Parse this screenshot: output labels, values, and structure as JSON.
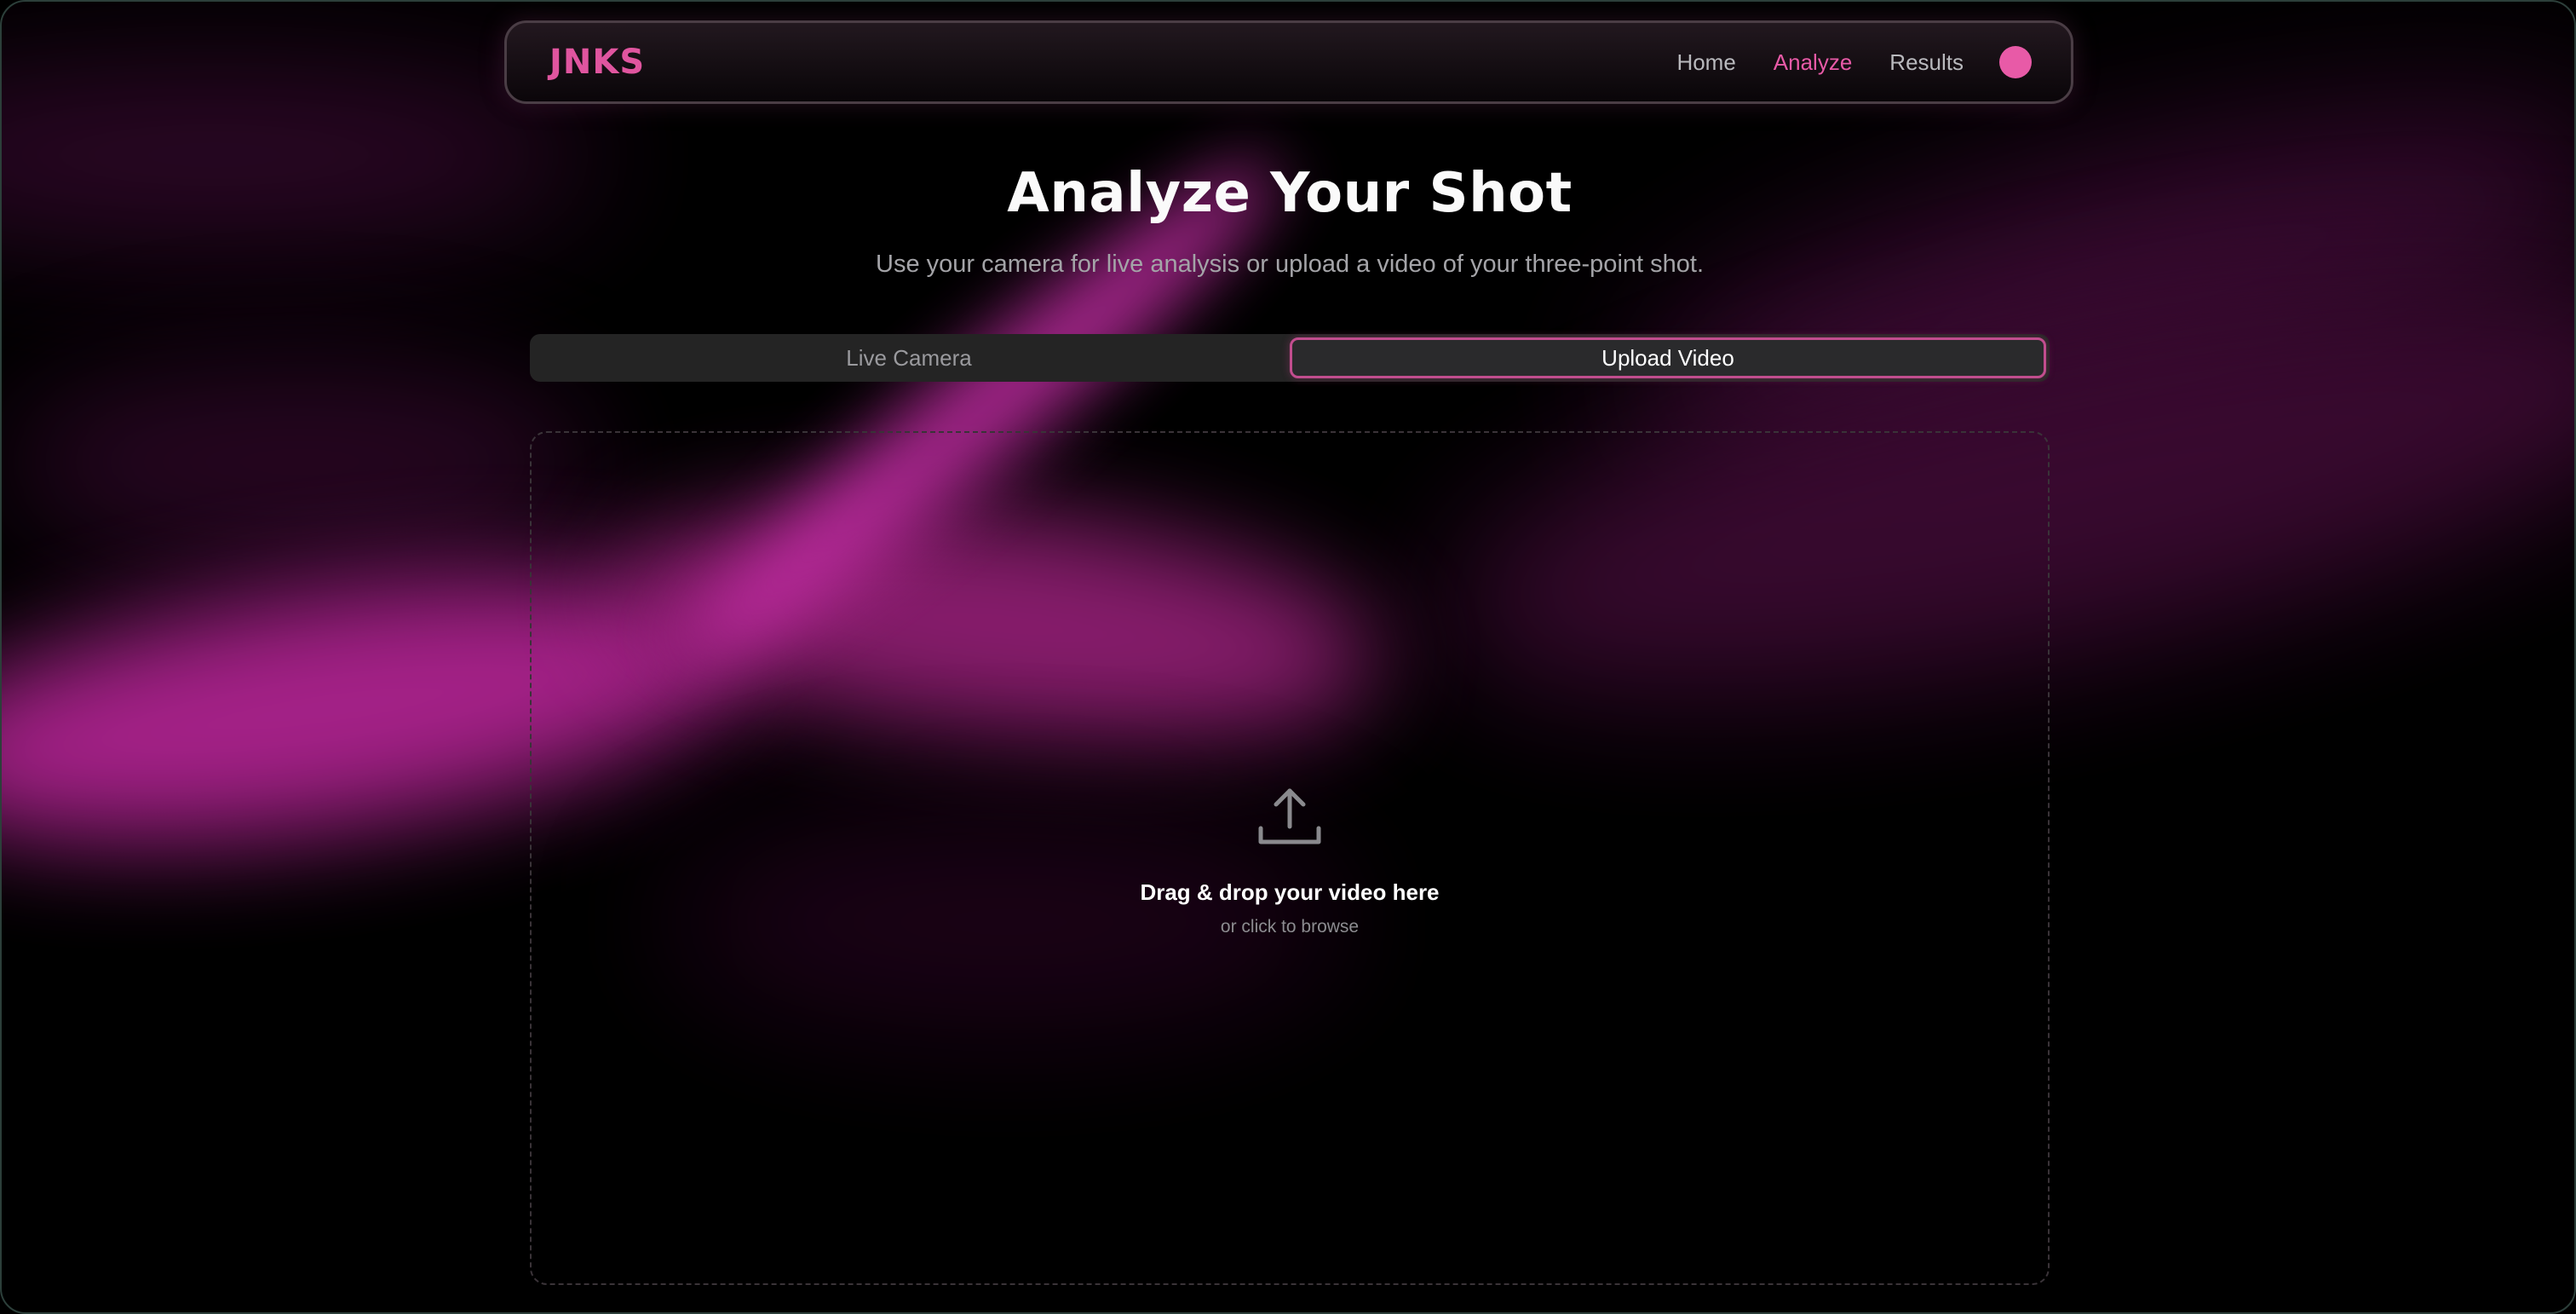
{
  "nav": {
    "logo": "JNKS",
    "links": [
      {
        "label": "Home",
        "active": false
      },
      {
        "label": "Analyze",
        "active": true
      },
      {
        "label": "Results",
        "active": false
      }
    ],
    "accent": "#e85aa7"
  },
  "page": {
    "title": "Analyze Your Shot",
    "subtitle": "Use your camera for live analysis or upload a video of your three-point shot."
  },
  "tabs": [
    {
      "label": "Live Camera",
      "active": false
    },
    {
      "label": "Upload Video",
      "active": true
    }
  ],
  "dropzone": {
    "icon": "upload-icon",
    "title": "Drag & drop your video here",
    "subtitle": "or click to browse"
  }
}
